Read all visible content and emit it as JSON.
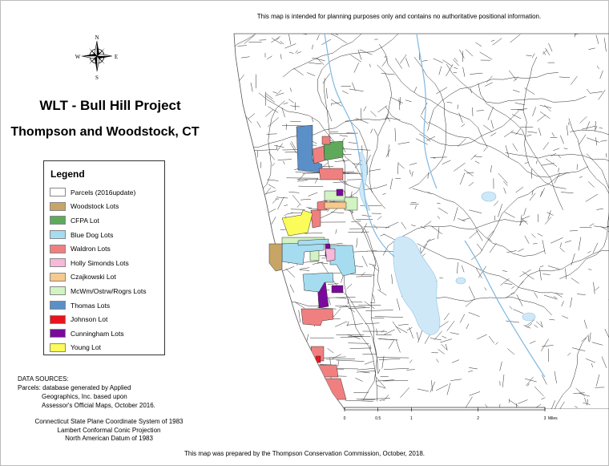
{
  "disclaimer": "This map is intended for planning purposes only and contains no authoritative positional information.",
  "title": "WLT - Bull Hill Project",
  "subtitle": "Thompson and Woodstock, CT",
  "compass": {
    "n": "N",
    "s": "S",
    "e": "E",
    "w": "W"
  },
  "legend": {
    "title": "Legend",
    "items": [
      {
        "label": "Parcels (2016update)",
        "color": "#ffffff"
      },
      {
        "label": "Woodstock Lots",
        "color": "#c8a567"
      },
      {
        "label": "CFPA Lot",
        "color": "#5faa5a"
      },
      {
        "label": "Blue Dog Lots",
        "color": "#a6dcef"
      },
      {
        "label": "Waldron Lots",
        "color": "#f08080"
      },
      {
        "label": "Holly Simonds Lots",
        "color": "#f7b8da"
      },
      {
        "label": "Czajkowski Lot",
        "color": "#f8c98c"
      },
      {
        "label": "McWm/Ostrw/Rogrs Lots",
        "color": "#d2f3c2"
      },
      {
        "label": "Thomas Lots",
        "color": "#5b8fc8"
      },
      {
        "label": "Johnson Lot",
        "color": "#e8141e"
      },
      {
        "label": "Cunningham Lots",
        "color": "#7a0a9c"
      },
      {
        "label": "Young Lot",
        "color": "#fbfb5a"
      }
    ]
  },
  "sources": {
    "heading": "DATA SOURCES:",
    "line1": "Parcels: database generated by Applied",
    "line2": "Geographics, Inc. based upon",
    "line3": "Assessor's Official Maps, October 2016."
  },
  "projection": {
    "line1": "Connecticut State Plane Coordinate System of 1983",
    "line2": "Lambert Conformal Conic Projection",
    "line3": "North American Datum of 1983"
  },
  "scale": {
    "ticks": [
      "0",
      "0.5",
      "1",
      "2",
      "3"
    ],
    "unit": "Miles"
  },
  "footer": "This map was prepared by the Thompson Conservation Commission, October, 2018."
}
